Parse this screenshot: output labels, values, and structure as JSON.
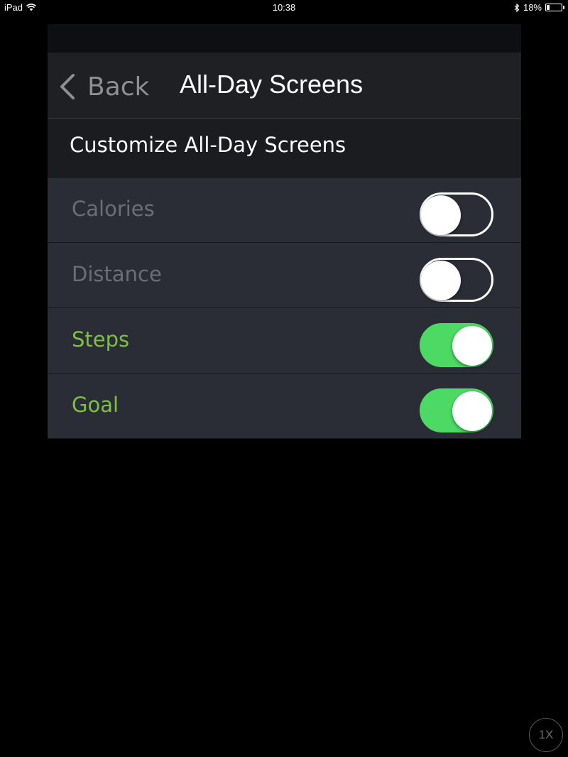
{
  "status_bar": {
    "device": "iPad",
    "time": "10:38",
    "battery_percent": "18%",
    "battery_level": 0.18,
    "icons": [
      "wifi-icon",
      "bluetooth-icon",
      "battery-icon"
    ]
  },
  "nav": {
    "back_label": "Back",
    "title": "All-Day Screens"
  },
  "section": {
    "title": "Customize All-Day Screens"
  },
  "rows": [
    {
      "label": "Calories",
      "enabled": false
    },
    {
      "label": "Distance",
      "enabled": false
    },
    {
      "label": "Steps",
      "enabled": true
    },
    {
      "label": "Goal",
      "enabled": true
    }
  ],
  "zoom": {
    "label": "1X"
  },
  "colors": {
    "enabled_label": "#7dc142",
    "disabled_label": "#6b6e75",
    "toggle_on": "#4cd964",
    "panel_bg": "#2a2d35",
    "nav_bg": "#1e2024"
  }
}
